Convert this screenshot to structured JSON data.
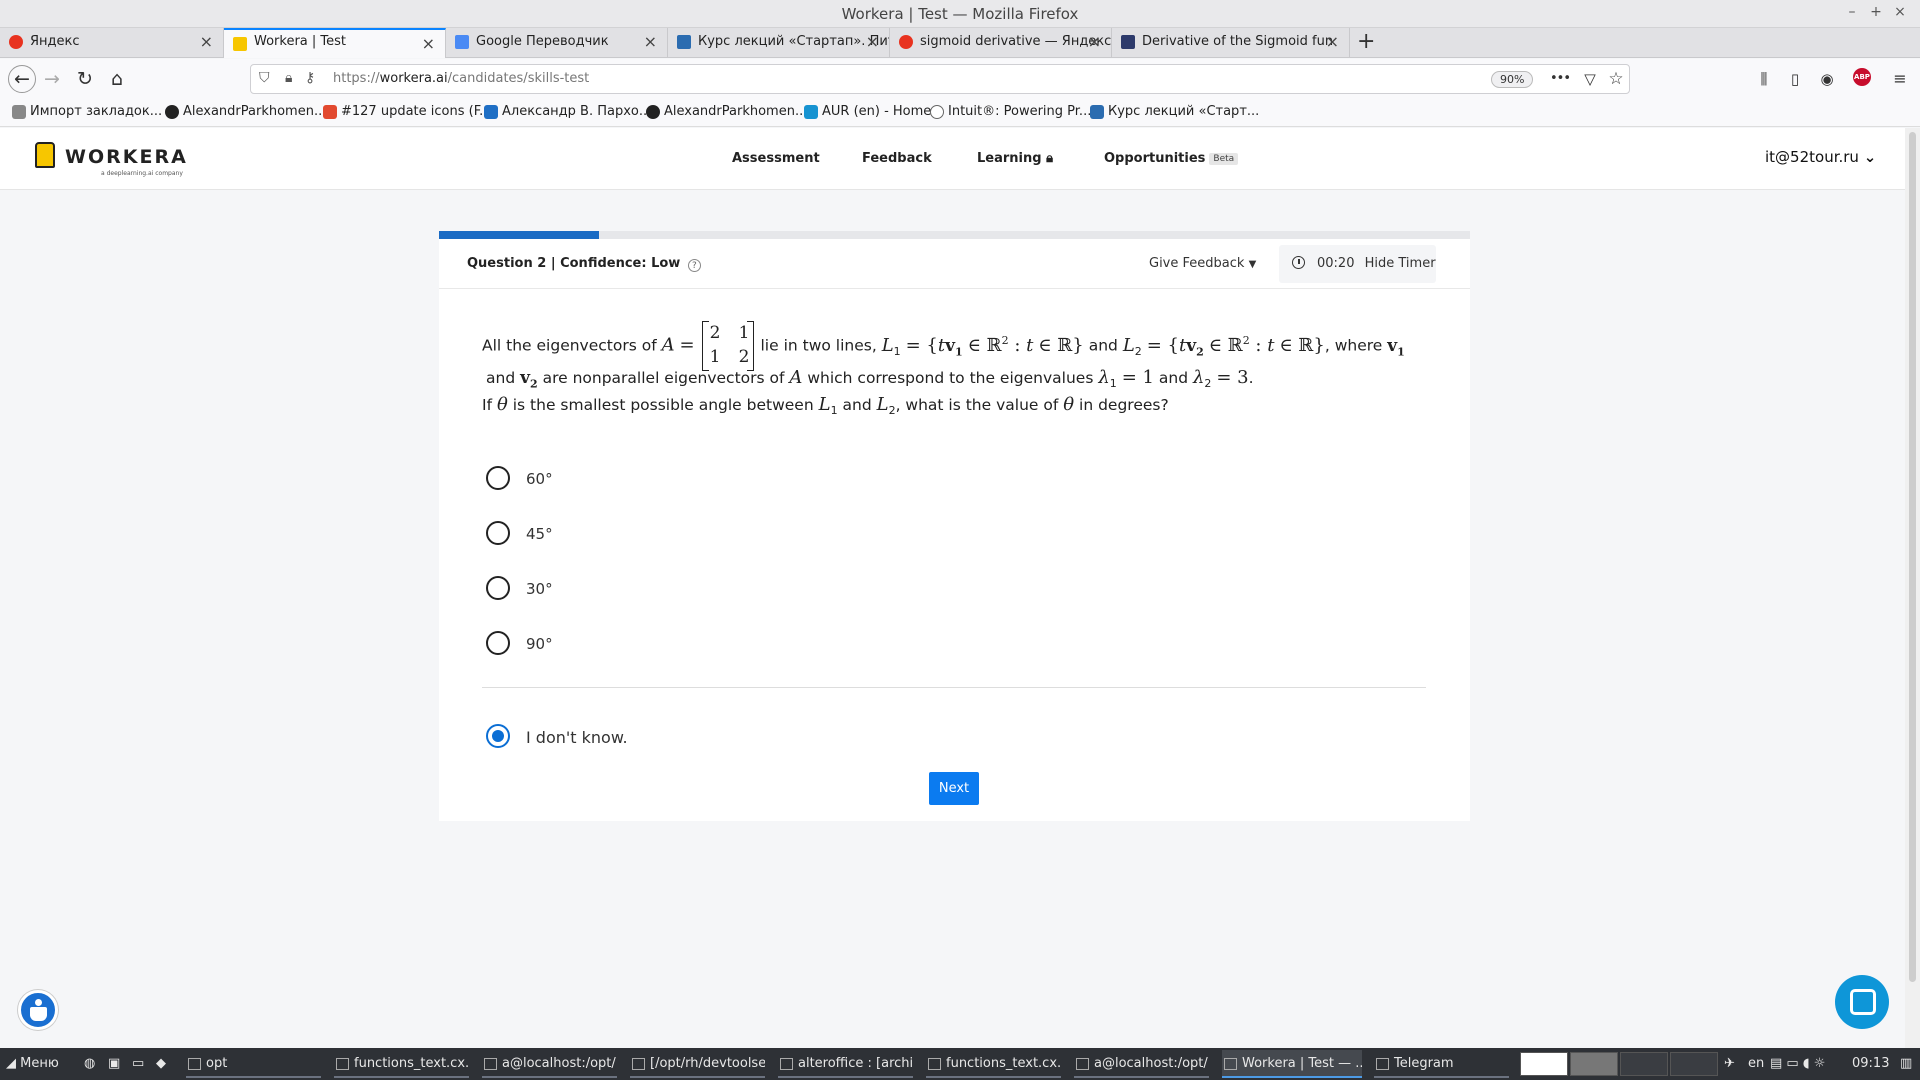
{
  "window": {
    "title": "Workera | Test — Mozilla Firefox",
    "controls": [
      "–",
      "+",
      "×"
    ]
  },
  "tabs": [
    {
      "label": "Яндекс",
      "color": "#e8321f"
    },
    {
      "label": "Workera | Test",
      "color": "#f7c600",
      "active": true
    },
    {
      "label": "Google Переводчик",
      "color": "#4a8af4"
    },
    {
      "label": "Курс лекций «Стартап». Пит",
      "color": "#2b6cb0"
    },
    {
      "label": "sigmoid derivative — Яндекс",
      "color": "#e8321f"
    },
    {
      "label": "Derivative of the Sigmoid fun",
      "color": "#2d3a6b"
    }
  ],
  "toolbar": {
    "back": "←",
    "forward": "→",
    "reload": "↻",
    "home": "⌂",
    "url_prefix": "https://",
    "url_host": "workera.ai",
    "url_path": "/candidates/skills-test",
    "zoom": "90%",
    "more": "•••",
    "abp": "ABP"
  },
  "bookmarks": [
    {
      "label": "Импорт закладок...",
      "color": "#888"
    },
    {
      "label": "AlexandrParkhomen...",
      "color": "#222"
    },
    {
      "label": "#127 update icons (F...",
      "color": "#e2492f"
    },
    {
      "label": "Александр В. Пархо...",
      "color": "#1f6fc5"
    },
    {
      "label": "AlexandrParkhomen...",
      "color": "#222"
    },
    {
      "label": "AUR (en) - Home",
      "color": "#1793d1"
    },
    {
      "label": "Intuit®: Powering Pr...",
      "color": "#666"
    },
    {
      "label": "Курс лекций «Старт...",
      "color": "#2b6cb0"
    }
  ],
  "site": {
    "logo_text": "WORKERA",
    "logo_sub": "a deeplearning.ai company",
    "nav": {
      "assessment": "Assessment",
      "feedback": "Feedback",
      "learning": "Learning",
      "opportunities": "Opportunities",
      "beta": "Beta"
    },
    "user": "it@52tour.ru"
  },
  "quiz": {
    "progress_percent": 15.5,
    "question_label": "Question 2 | Confidence:",
    "confidence": "Low",
    "help": "?",
    "give_feedback": "Give Feedback",
    "timer": "00:20",
    "hide_timer": "Hide Timer",
    "question": {
      "l1_a": "All the eigenvectors of",
      "l1_b": "lie in two lines,",
      "l1_c": "and",
      "l1_d": ", where",
      "l2_a": "and",
      "l2_b": "are nonparallel eigenvectors of",
      "l2_c": "which correspond to the eigenvalues",
      "l2_d": "and",
      "l3_a": "If",
      "l3_b": "is the smallest possible angle between",
      "l3_c": "and",
      "l3_d": ", what is the value of",
      "l3_e": "in degrees?"
    },
    "matrix": [
      "2",
      "1",
      "1",
      "2"
    ],
    "options": [
      "60°",
      "45°",
      "30°",
      "90°"
    ],
    "dont_know": "I don't know.",
    "next": "Next"
  },
  "taskbar": {
    "menu": "Меню",
    "items": [
      {
        "label": "opt"
      },
      {
        "label": "functions_text.cx..."
      },
      {
        "label": "a@localhost:/opt/..."
      },
      {
        "label": "[/opt/rh/devtoolse..."
      },
      {
        "label": "alteroffice : [archi..."
      },
      {
        "label": "functions_text.cx..."
      },
      {
        "label": "a@localhost:/opt/..."
      },
      {
        "label": "Workera | Test — ...",
        "active": true
      },
      {
        "label": "Telegram"
      }
    ],
    "lang": "en",
    "clock": "09:13"
  }
}
